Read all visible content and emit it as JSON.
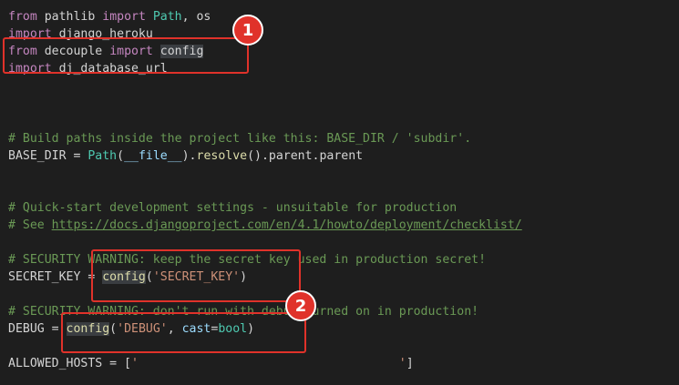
{
  "code": {
    "l1": {
      "kw1": "from",
      "mod": "pathlib",
      "kw2": "import",
      "cls": "Path",
      "rest": ", os"
    },
    "l2": {
      "kw": "import",
      "mod": "django_heroku"
    },
    "l3": {
      "kw1": "from",
      "mod": "decouple",
      "kw2": "import",
      "name": "config"
    },
    "l4": {
      "kw": "import",
      "mod": "dj_database_url"
    },
    "c1": "# Build paths inside the project like this: BASE_DIR / 'subdir'.",
    "l6": {
      "var": "BASE_DIR",
      "eq": " = ",
      "cls": "Path",
      "p1": "(",
      "file": "__file__",
      "p2": ").",
      "fn": "resolve",
      "p3": "()",
      "rest": ".parent.parent"
    },
    "c2": "# Quick-start development settings - unsuitable for production",
    "c3": {
      "prefix": "# See ",
      "url": "https://docs.djangoproject.com/en/4.1/howto/deployment/checklist/"
    },
    "c4": "# SECURITY WARNING: keep the secret key used in production secret!",
    "l10": {
      "var": "SECRET_KEY",
      "eq": " = ",
      "fn": "config",
      "p1": "(",
      "str": "'SECRET_KEY'",
      "p2": ")"
    },
    "c5": "# SECURITY WARNING: don't run with debug turned on in production!",
    "l12": {
      "var": "DEBUG",
      "eq": " = ",
      "fn": "config",
      "p1": "(",
      "str": "'DEBUG'",
      "comma": ", ",
      "param": "cast",
      "eq2": "=",
      "cls": "bool",
      "p2": ")"
    },
    "l13": {
      "var": "ALLOWED_HOSTS",
      "eq": " = ",
      "br1": "[",
      "str": "'                                    '",
      "br2": "]"
    }
  },
  "annotations": {
    "badge1": "1",
    "badge2": "2"
  },
  "colors": {
    "background": "#1e1e1e",
    "callout": "#e0322a"
  }
}
